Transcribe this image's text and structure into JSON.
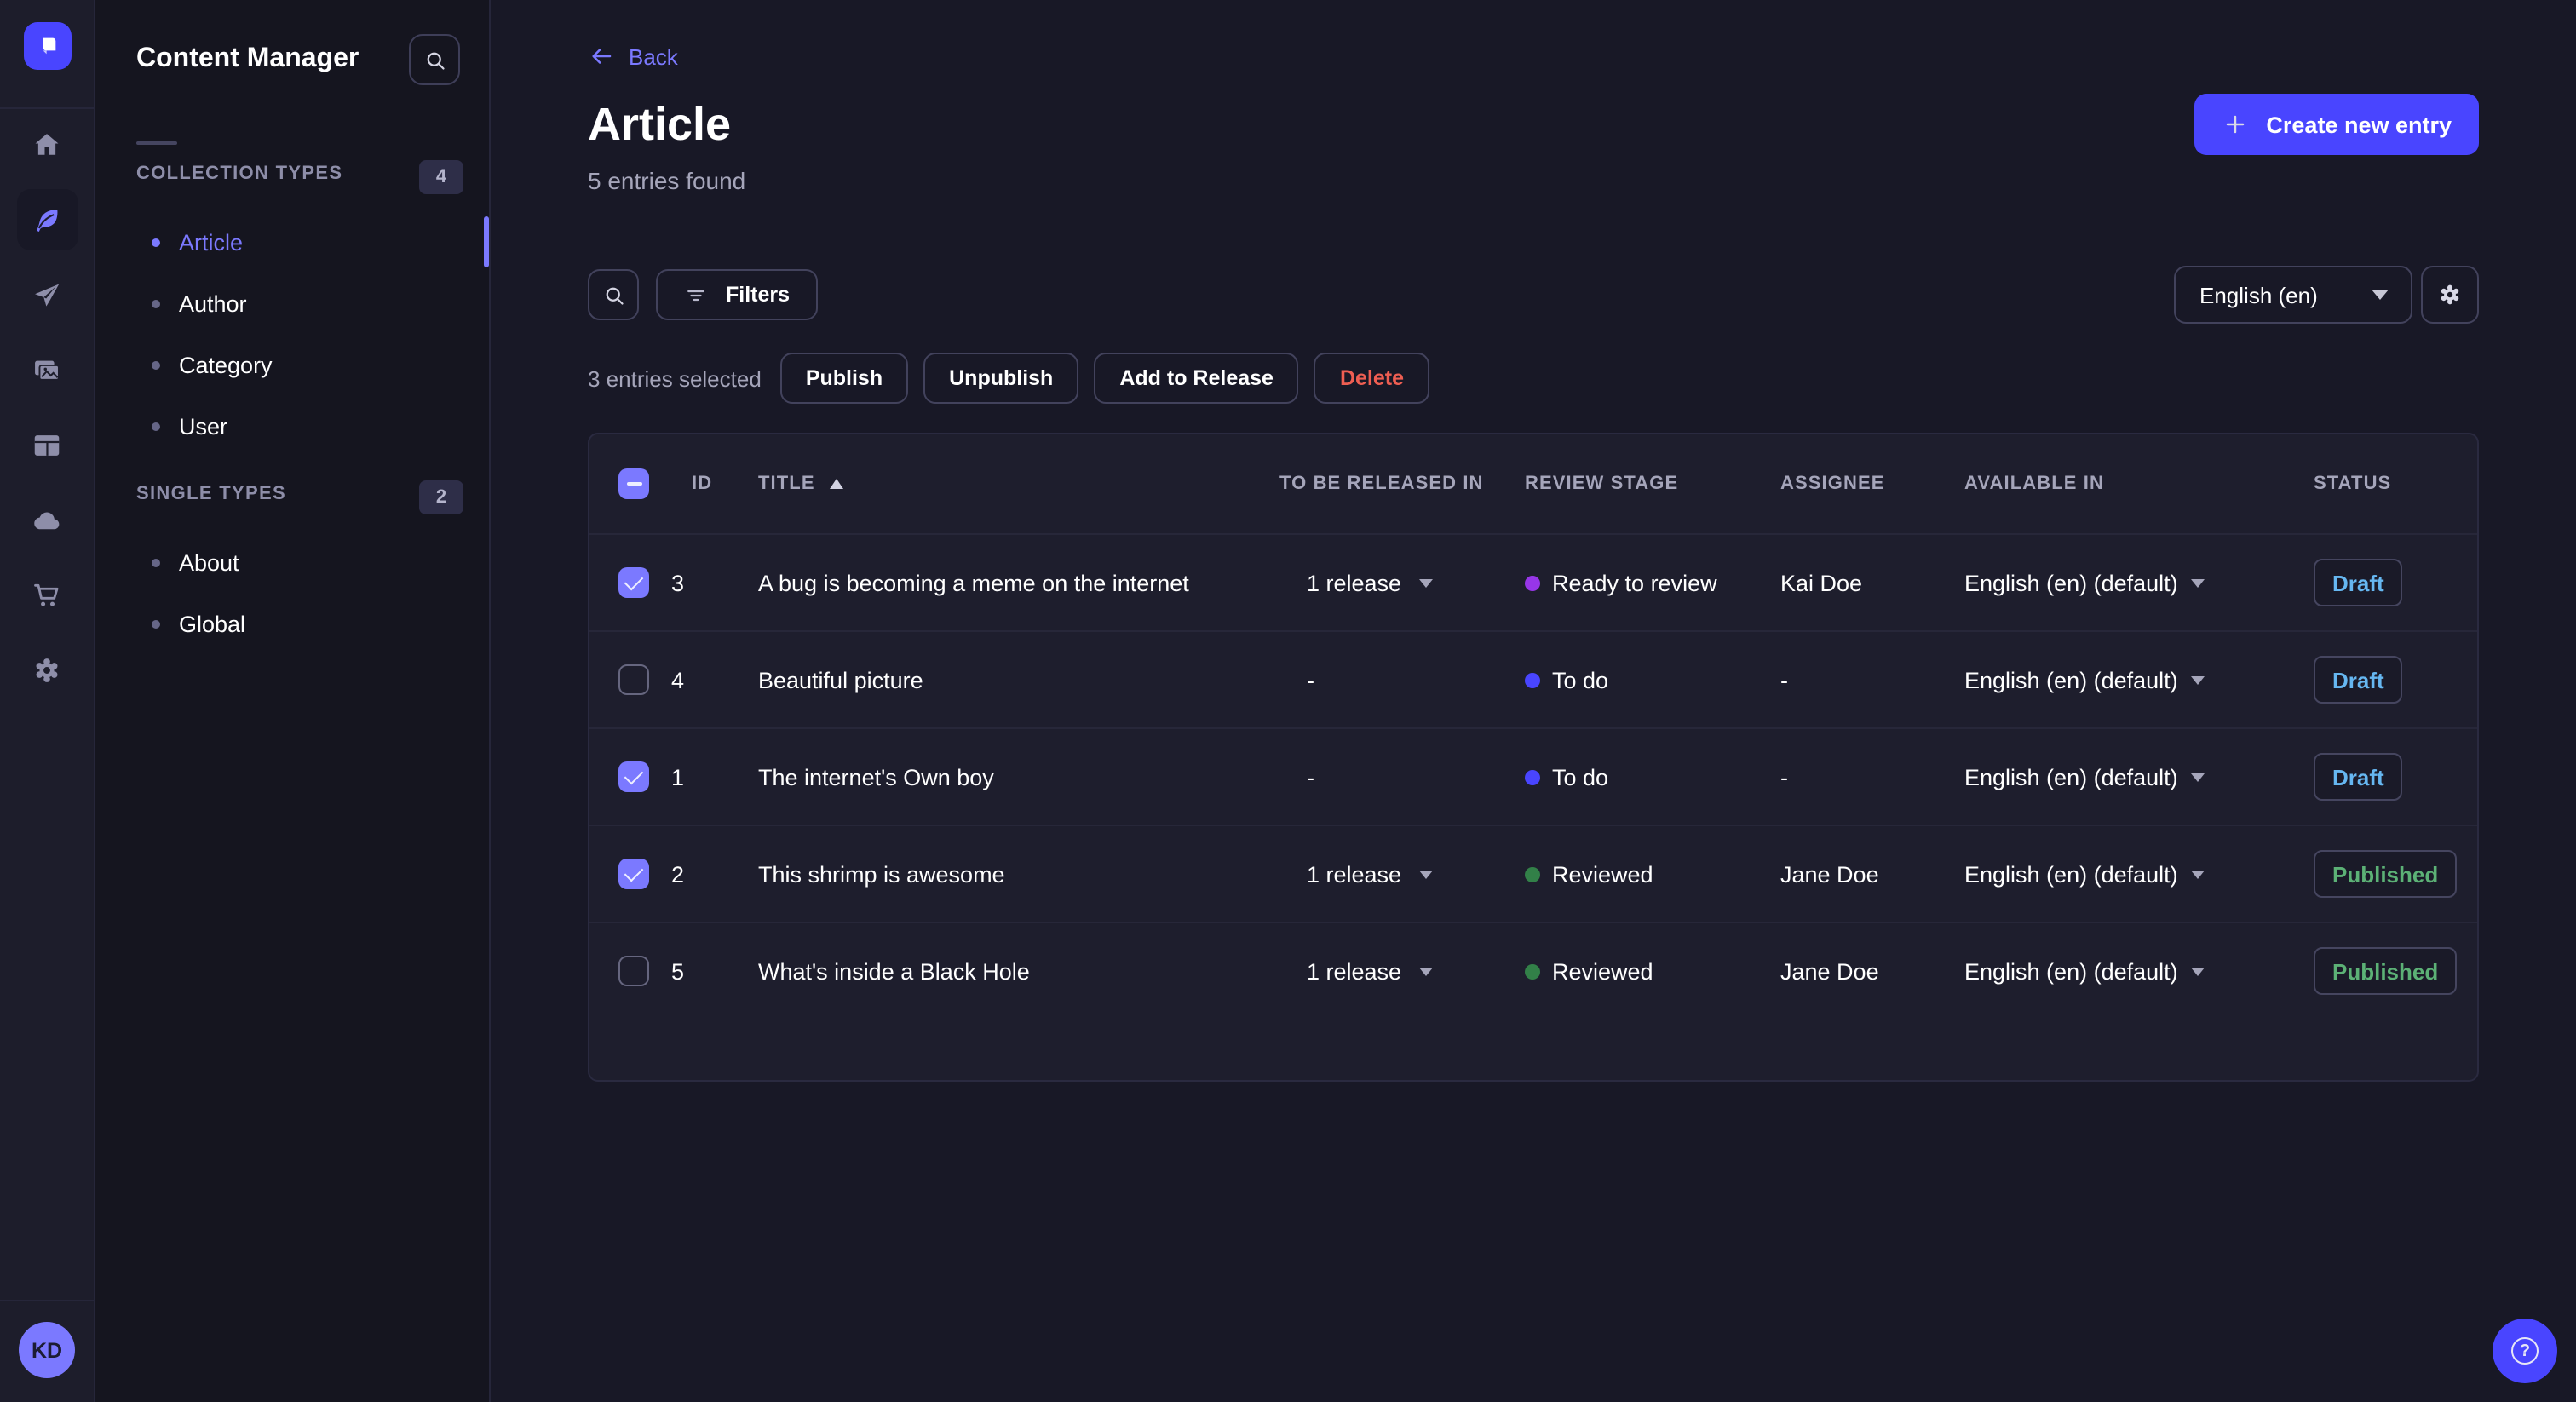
{
  "colors": {
    "accent": "#4945ff",
    "link": "#7b79ff",
    "text_muted": "#a5a5ba",
    "danger": "#ee5e52",
    "draft_text": "#66b7f1",
    "published_text": "#5cb176",
    "stage_ready_to_review": "#9736e8",
    "stage_to_do": "#4945ff",
    "stage_reviewed": "#328048",
    "checkbox": "#7b79ff"
  },
  "rail": {
    "items": [
      {
        "icon": "home"
      },
      {
        "icon": "content-manager-feather",
        "active": true
      },
      {
        "icon": "send-plane"
      },
      {
        "icon": "media-library"
      },
      {
        "icon": "content-type-builder"
      },
      {
        "icon": "cloud"
      },
      {
        "icon": "marketplace-cart"
      },
      {
        "icon": "settings-gear"
      }
    ]
  },
  "user": {
    "initials": "KD"
  },
  "sidebar": {
    "title": "Content Manager",
    "sections": [
      {
        "label": "COLLECTION TYPES",
        "count": "4",
        "items": [
          {
            "label": "Article",
            "active": true
          },
          {
            "label": "Author"
          },
          {
            "label": "Category"
          },
          {
            "label": "User"
          }
        ]
      },
      {
        "label": "SINGLE TYPES",
        "count": "2",
        "items": [
          {
            "label": "About"
          },
          {
            "label": "Global"
          }
        ]
      }
    ]
  },
  "page": {
    "back_label": "Back",
    "title": "Article",
    "subtitle": "5 entries found",
    "create_button": "Create new entry"
  },
  "toolbar": {
    "filters_label": "Filters",
    "locale": "English (en)"
  },
  "selection": {
    "label": "3 entries selected",
    "buttons": [
      {
        "label": "Publish"
      },
      {
        "label": "Unpublish"
      },
      {
        "label": "Add to Release"
      },
      {
        "label": "Delete",
        "variant": "danger"
      }
    ]
  },
  "table": {
    "header_checkbox": "indeterminate",
    "columns": [
      {
        "label": "ID"
      },
      {
        "label": "TITLE",
        "sorted": "asc"
      },
      {
        "label": "TO BE RELEASED IN"
      },
      {
        "label": "REVIEW STAGE"
      },
      {
        "label": "ASSIGNEE"
      },
      {
        "label": "AVAILABLE IN"
      },
      {
        "label": "STATUS"
      }
    ],
    "rows": [
      {
        "checked": true,
        "id": "3",
        "title": "A bug is becoming a meme on the internet",
        "to_be_released_in": "1 release",
        "review_stage": "Ready to review",
        "stage_color": "#9736e8",
        "assignee": "Kai Doe",
        "available_in": "English (en) (default)",
        "status": "Draft"
      },
      {
        "checked": false,
        "id": "4",
        "title": "Beautiful picture",
        "to_be_released_in": "-",
        "review_stage": "To do",
        "stage_color": "#4945ff",
        "assignee": "-",
        "available_in": "English (en) (default)",
        "status": "Draft"
      },
      {
        "checked": true,
        "id": "1",
        "title": "The internet's Own boy",
        "to_be_released_in": "-",
        "review_stage": "To do",
        "stage_color": "#4945ff",
        "assignee": "-",
        "available_in": "English (en) (default)",
        "status": "Draft"
      },
      {
        "checked": true,
        "id": "2",
        "title": "This shrimp is awesome",
        "to_be_released_in": "1 release",
        "review_stage": "Reviewed",
        "stage_color": "#328048",
        "assignee": "Jane Doe",
        "available_in": "English (en) (default)",
        "status": "Published"
      },
      {
        "checked": false,
        "id": "5",
        "title": "What's inside a Black Hole",
        "to_be_released_in": "1 release",
        "review_stage": "Reviewed",
        "stage_color": "#328048",
        "assignee": "Jane Doe",
        "available_in": "English (en) (default)",
        "status": "Published"
      }
    ]
  },
  "help": {
    "icon_glyph": "?"
  }
}
